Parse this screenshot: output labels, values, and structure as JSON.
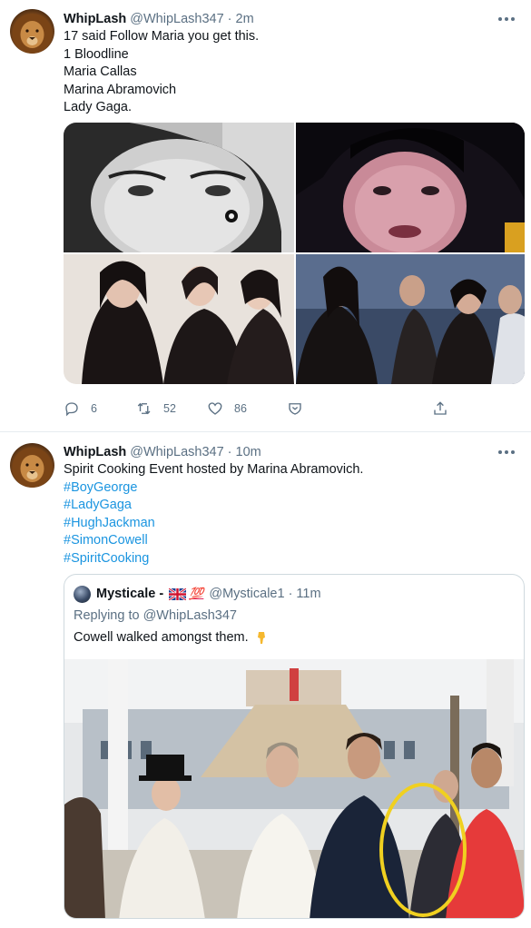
{
  "tweets": [
    {
      "name": "WhipLash",
      "handle": "@WhipLash347",
      "separator": "·",
      "time": "2m",
      "lines": [
        "17 said Follow Maria you get this.",
        "1 Bloodline",
        "Maria Callas",
        "Marina Abramovich",
        "Lady Gaga."
      ],
      "stats": {
        "replies": "6",
        "retweets": "52",
        "likes": "86"
      }
    },
    {
      "name": "WhipLash",
      "handle": "@WhipLash347",
      "separator": "·",
      "time": "10m",
      "text": "Spirit Cooking Event hosted by Marina Abramovich.",
      "hashtags": [
        "#BoyGeorge",
        "#LadyGaga",
        "#HughJackman",
        "#SimonCowell",
        "#SpiritCooking"
      ]
    }
  ],
  "quoted": {
    "name": "Mysticale -",
    "hundred": "💯",
    "handle": "@Mysticale1",
    "separator": "·",
    "time": "11m",
    "replying_prefix": "Replying to",
    "replying_to": "@WhipLash347",
    "text": "Cowell walked amongst them.",
    "emoji_icon": "backhand-index-pointing-down"
  },
  "colors": {
    "text": "#0f1419",
    "secondary": "#5b7083",
    "link": "#1b95e0",
    "border": "#cfd9de",
    "highlight_circle": "#f0d020"
  }
}
